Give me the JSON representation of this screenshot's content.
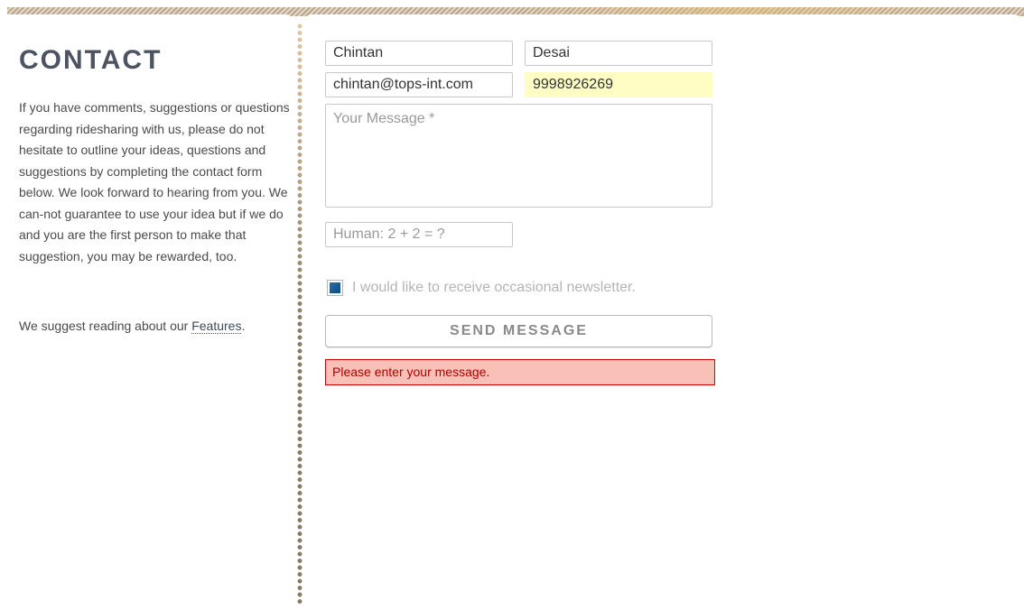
{
  "sidebar": {
    "title": "CONTACT",
    "intro": "If you have comments, suggestions or questions regarding ridesharing with us, please do not hesitate to outline your ideas, questions and suggestions by completing the contact form below. We look forward to hearing from you. We can-not guarantee to use your idea but if we do and you are the first person to make that suggestion, you may be rewarded, too.",
    "suggest_prefix": "We suggest reading about our ",
    "features_link": "Features",
    "suggest_suffix": "."
  },
  "form": {
    "first_name": "Chintan",
    "last_name": "Desai",
    "email": "chintan@tops-int.com",
    "phone": "9998926269",
    "message_placeholder": "Your Message *",
    "message_value": "",
    "human_placeholder": "Human: 2 + 2 = ?",
    "newsletter_label": "I would like to receive occasional newsletter.",
    "newsletter_checked": true,
    "send_label": "SEND MESSAGE",
    "error_message": "Please enter your message."
  },
  "colors": {
    "title": "#4d5360",
    "phone_highlight": "#fdfdc4",
    "error_bg": "#f8c0b6",
    "error_border": "#cc0000",
    "error_text": "#b00000",
    "checkbox_fill": "#1c5a8f"
  }
}
